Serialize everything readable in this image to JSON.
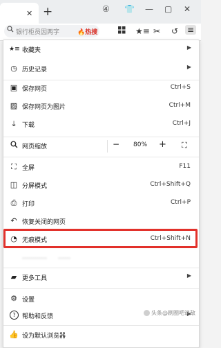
{
  "tabbar": {
    "close_glyph": "✕",
    "new_tab_glyph": "+",
    "right_icons": [
      "④",
      "👕",
      "—",
      "▢",
      "✕"
    ]
  },
  "toolbar": {
    "search_text": "银行柜员因两字",
    "hot_label": "🔥热搜",
    "icons": [
      "grid-icon",
      "star-list-icon",
      "scissors-icon",
      "undo-icon",
      "menu-icon"
    ]
  },
  "menu": {
    "items": [
      {
        "label": "收藏夹",
        "shortcut": "",
        "icon": "★≡",
        "submenu": true
      },
      {
        "label": "历史记录",
        "shortcut": "",
        "icon": "◷",
        "submenu": true
      },
      {
        "label": "保存网页",
        "shortcut": "Ctrl+S",
        "icon": "▣",
        "submenu": false
      },
      {
        "label": "保存网页为图片",
        "shortcut": "Ctrl+M",
        "icon": "▨",
        "submenu": false
      },
      {
        "label": "下载",
        "shortcut": "Ctrl+J",
        "icon": "⤓",
        "submenu": false
      }
    ],
    "zoom": {
      "label": "网页缩放",
      "minus": "−",
      "value": "80%",
      "plus": "+",
      "fullscreen_glyph": "⛶"
    },
    "items2": [
      {
        "label": "全屏",
        "shortcut": "F11",
        "icon": "⛶"
      },
      {
        "label": "分屏模式",
        "shortcut": "Ctrl+Shift+Q",
        "icon": "◫"
      },
      {
        "label": "打印",
        "shortcut": "Ctrl+P",
        "icon": "⎙"
      },
      {
        "label": "恢复关闭的网页",
        "shortcut": "",
        "icon": "↶"
      },
      {
        "label": "无痕模式",
        "shortcut": "Ctrl+Shift+N",
        "icon": "◔"
      }
    ],
    "obscured": {
      "label": "…………",
      "shortcut": "……"
    },
    "more_tools": {
      "label": "更多工具",
      "icon": "▰"
    },
    "settings": {
      "label": "设置",
      "icon": "⚙"
    },
    "help": {
      "label": "帮助和反馈",
      "icon": "?"
    },
    "default_browser": {
      "label": "设为默认浏览器",
      "icon": "👍"
    }
  },
  "watermark": {
    "text": "头条@刷圈吧说敌"
  },
  "colors": {
    "highlight": "#e2312b",
    "hot": "#d9342b"
  }
}
